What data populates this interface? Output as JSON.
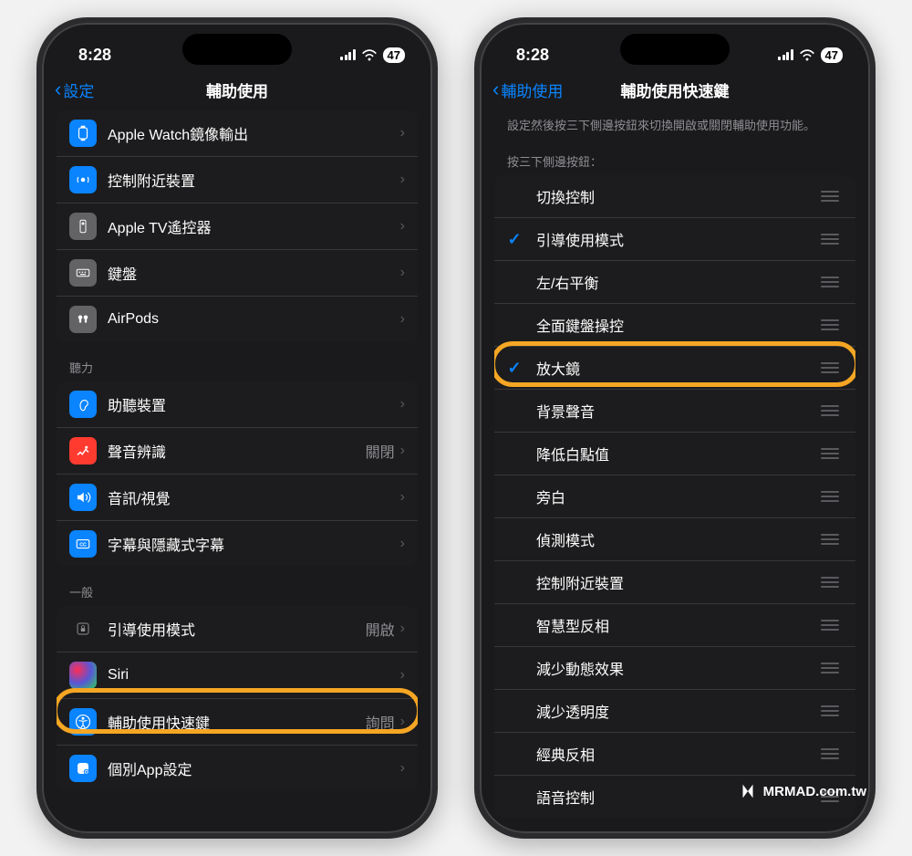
{
  "status": {
    "time": "8:28",
    "battery": "47"
  },
  "left": {
    "back": "設定",
    "title": "輔助使用",
    "group1": [
      {
        "label": "Apple Watch鏡像輸出",
        "icon": "watch",
        "bg": "#0a84ff"
      },
      {
        "label": "控制附近裝置",
        "icon": "nearby",
        "bg": "#0a84ff"
      },
      {
        "label": "Apple TV遙控器",
        "icon": "remote",
        "bg": "#636366"
      },
      {
        "label": "鍵盤",
        "icon": "keyboard",
        "bg": "#636366"
      },
      {
        "label": "AirPods",
        "icon": "airpods",
        "bg": "#636366"
      }
    ],
    "section2_header": "聽力",
    "group2": [
      {
        "label": "助聽裝置",
        "icon": "ear",
        "bg": "#0a84ff"
      },
      {
        "label": "聲音辨識",
        "icon": "sound",
        "bg": "#ff3b30",
        "value": "關閉"
      },
      {
        "label": "音訊/視覺",
        "icon": "speaker",
        "bg": "#0a84ff"
      },
      {
        "label": "字幕與隱藏式字幕",
        "icon": "cc",
        "bg": "#0a84ff"
      }
    ],
    "section3_header": "一般",
    "group3": [
      {
        "label": "引導使用模式",
        "icon": "lock",
        "bg": "#1c1c1e",
        "value": "開啟"
      },
      {
        "label": "Siri",
        "icon": "siri",
        "bg": "gradient"
      },
      {
        "label": "輔助使用快速鍵",
        "icon": "accessibility",
        "bg": "#0a84ff",
        "value": "詢問",
        "highlight": true
      },
      {
        "label": "個別App設定",
        "icon": "appsettings",
        "bg": "#0a84ff"
      }
    ]
  },
  "right": {
    "back": "輔助使用",
    "title": "輔助使用快速鍵",
    "description": "設定然後按三下側邊按鈕來切換開啟或關閉輔助使用功能。",
    "list_header": "按三下側邊按鈕：",
    "items": [
      {
        "label": "切換控制",
        "checked": false
      },
      {
        "label": "引導使用模式",
        "checked": true
      },
      {
        "label": "左/右平衡",
        "checked": false
      },
      {
        "label": "全面鍵盤操控",
        "checked": false
      },
      {
        "label": "放大鏡",
        "checked": true,
        "highlight": true
      },
      {
        "label": "背景聲音",
        "checked": false
      },
      {
        "label": "降低白點值",
        "checked": false
      },
      {
        "label": "旁白",
        "checked": false
      },
      {
        "label": "偵測模式",
        "checked": false
      },
      {
        "label": "控制附近裝置",
        "checked": false
      },
      {
        "label": "智慧型反相",
        "checked": false
      },
      {
        "label": "減少動態效果",
        "checked": false
      },
      {
        "label": "減少透明度",
        "checked": false
      },
      {
        "label": "經典反相",
        "checked": false
      },
      {
        "label": "語音控制",
        "checked": false
      }
    ]
  },
  "watermark": "MRMAD.com.tw"
}
